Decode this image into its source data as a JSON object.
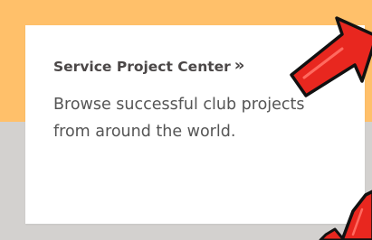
{
  "card": {
    "title": "Service Project Center",
    "chevron": "»",
    "description": "Browse successful club projects from around the world."
  },
  "colors": {
    "top_band": "#ffc06a",
    "bottom_band": "#d3d1cf",
    "arrow": "#e8271f"
  },
  "icons": {
    "top": "red-pointer-arrow",
    "bottom": "red-pointer-arrow"
  }
}
